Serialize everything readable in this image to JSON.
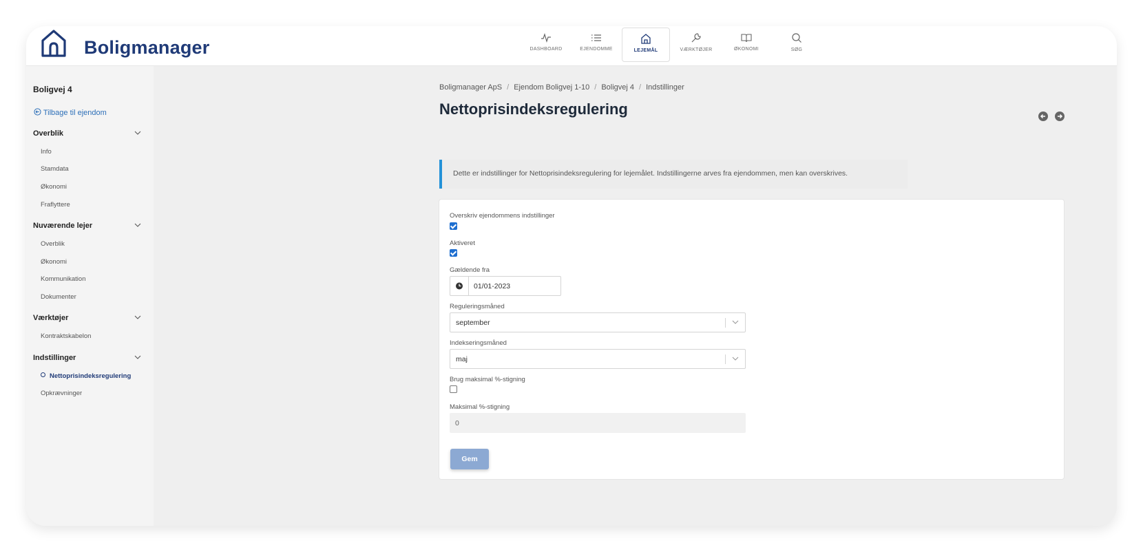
{
  "app": {
    "name": "Boligmanager"
  },
  "nav": [
    {
      "label": "DASHBOARD",
      "icon": "activity-icon",
      "active": false
    },
    {
      "label": "EJENDOMME",
      "icon": "list-icon",
      "active": false
    },
    {
      "label": "LEJEMÅL",
      "icon": "home-icon",
      "active": true
    },
    {
      "label": "VÆRKTØJER",
      "icon": "wrench-icon",
      "active": false
    },
    {
      "label": "ØKONOMI",
      "icon": "book-icon",
      "active": false
    },
    {
      "label": "SØG",
      "icon": "search-icon",
      "active": false
    }
  ],
  "sidebar": {
    "title": "Boligvej 4",
    "back_label": "Tilbage til ejendom",
    "sections": [
      {
        "label": "Overblik",
        "items": [
          "Info",
          "Stamdata",
          "Økonomi",
          "Fraflyttere"
        ]
      },
      {
        "label": "Nuværende lejer",
        "items": [
          "Overblik",
          "Økonomi",
          "Kommunikation",
          "Dokumenter"
        ]
      },
      {
        "label": "Værktøjer",
        "items": [
          "Kontraktskabelon"
        ]
      },
      {
        "label": "Indstillinger",
        "items": [
          "Nettoprisindeksregulering",
          "Opkrævninger"
        ],
        "active_item": "Nettoprisindeksregulering"
      }
    ]
  },
  "breadcrumb": [
    "Boligmanager ApS",
    "Ejendom Boligvej 1-10",
    "Boligvej 4",
    "Indstillinger"
  ],
  "page": {
    "title": "Nettoprisindeksregulering",
    "info": "Dette er indstillinger for Nettoprisindeksregulering for lejemålet. Indstillingerne arves fra ejendommen, men kan overskrives."
  },
  "form": {
    "override": {
      "label": "Overskriv ejendommens indstillinger",
      "checked": true
    },
    "activated": {
      "label": "Aktiveret",
      "checked": true
    },
    "valid_from": {
      "label": "Gældende fra",
      "value": "01/01-2023"
    },
    "regulation_month": {
      "label": "Reguleringsmåned",
      "value": "september"
    },
    "indexing_month": {
      "label": "Indekseringsmåned",
      "value": "maj"
    },
    "use_max": {
      "label": "Brug maksimal %-stigning",
      "checked": false
    },
    "max_increase": {
      "label": "Maksimal %-stigning",
      "value": "0"
    },
    "save_label": "Gem"
  },
  "colors": {
    "brand": "#1f3a77",
    "accent": "#2492d8",
    "button": "#8ca9d3"
  }
}
